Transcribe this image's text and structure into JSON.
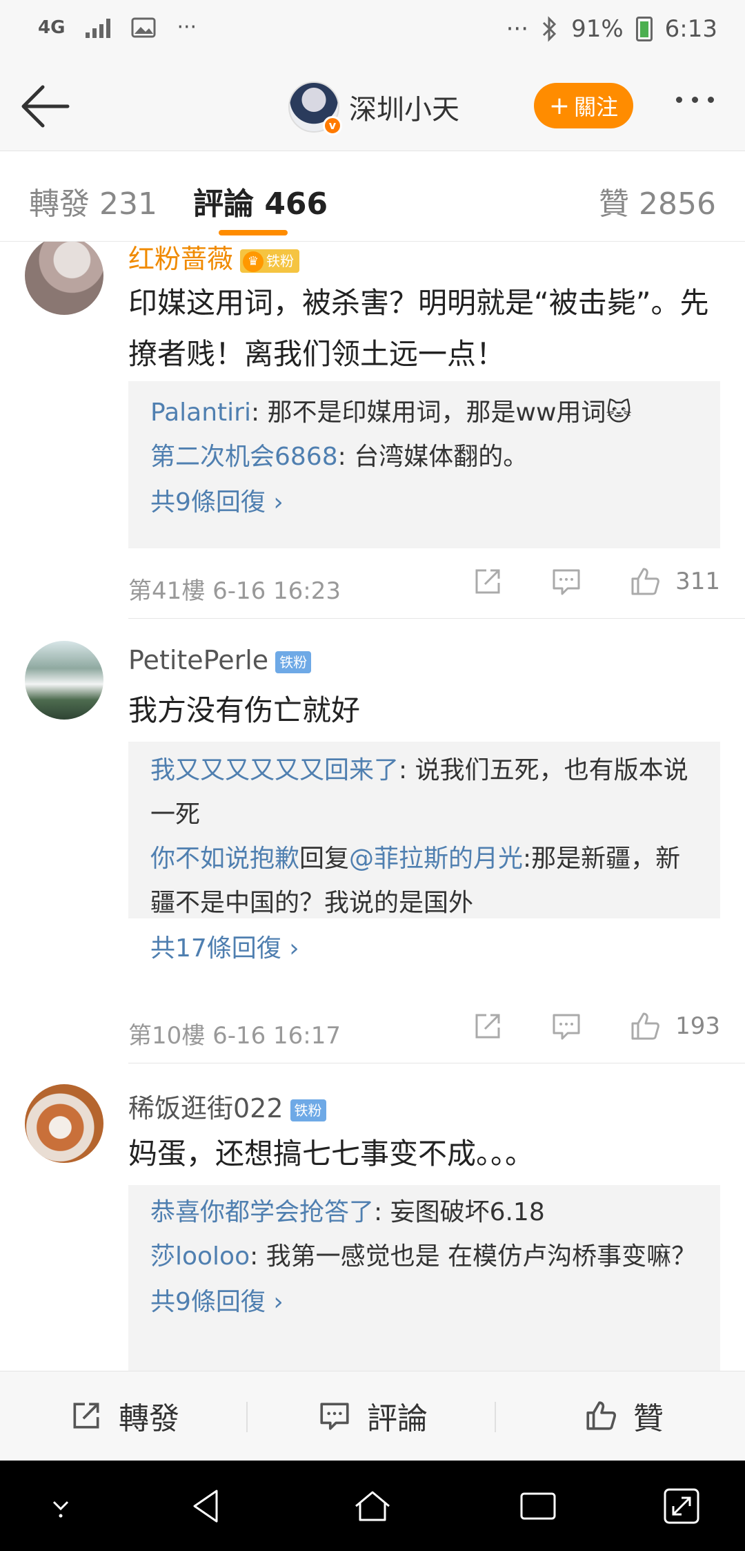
{
  "status_bar": {
    "network": "4G",
    "more_left": "···",
    "more_right": "···",
    "battery": "91%",
    "time": "6:13"
  },
  "header": {
    "user_name": "深圳小天",
    "follow_label": "關注"
  },
  "tabs": {
    "repost": "轉發 231",
    "comment": "評論 466",
    "like": "贊 2856"
  },
  "comments": [
    {
      "author": "红粉蔷薇",
      "badge": "铁粉",
      "text": "印媒这用词，被杀害？明明就是“被击毙”。先撩者贱！离我们领土远一点！",
      "replies": [
        {
          "author": "Palantiri",
          "text": ": 那不是印媒用词，那是ww用词🐱"
        },
        {
          "author": "第二次机会6868",
          "text": ": 台湾媒体翻的。"
        }
      ],
      "more_replies": "共9條回復 ›",
      "floor": "第41樓  6-16 16:23",
      "likes": "311"
    },
    {
      "author": "PetitePerle",
      "badge": "铁粉",
      "text": "我方没有伤亡就好",
      "replies": [
        {
          "author": "我又又又又又又回来了",
          "text": ": 说我们五死，也有版本说一死"
        },
        {
          "author": "你不如说抱歉",
          "mid": "回复",
          "mention": "@菲拉斯的月光",
          "text": ":那是新疆，新疆不是中国的？我说的是国外"
        }
      ],
      "more_replies": "共17條回復 ›",
      "floor": "第10樓  6-16 16:17",
      "likes": "193"
    },
    {
      "author": "稀饭逛街022",
      "badge": "铁粉",
      "text": "妈蛋，还想搞七七事变不成。。。",
      "replies": [
        {
          "author": "恭喜你都学会抢答了",
          "text": ": 妄图破坏6.18"
        },
        {
          "author": "莎looloo",
          "text": ": 我第一感觉也是  在模仿卢沟桥事变嘛？"
        }
      ],
      "more_replies": "共9條回復 ›"
    }
  ],
  "action_bar": {
    "repost": "轉發",
    "comment": "評論",
    "like": "贊"
  },
  "colors": {
    "accent": "#ff8c00",
    "link": "#4f7fb0",
    "gold_name": "#f08a00"
  }
}
